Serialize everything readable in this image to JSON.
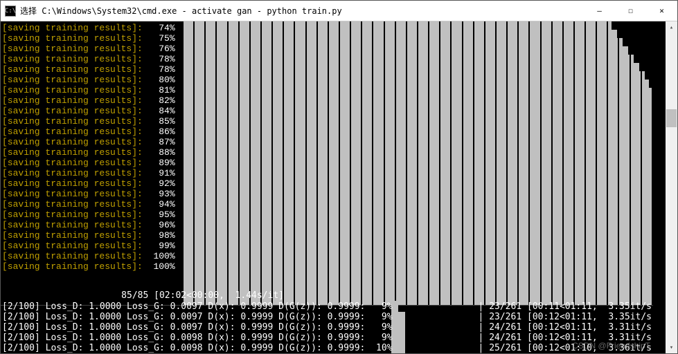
{
  "window": {
    "title": "选择 C:\\Windows\\System32\\cmd.exe - activate  gan - python  train.py",
    "icon_text": "C:\\",
    "btn_min": "—",
    "btn_max": "☐",
    "btn_close": "✕"
  },
  "saving": {
    "label": "[saving training results]:",
    "percents": [
      "74%",
      "75%",
      "76%",
      "78%",
      "78%",
      "80%",
      "81%",
      "82%",
      "84%",
      "85%",
      "86%",
      "87%",
      "88%",
      "89%",
      "91%",
      "92%",
      "93%",
      "94%",
      "95%",
      "96%",
      "98%",
      "99%",
      "100%",
      "100%"
    ]
  },
  "progress": {
    "line": "85/85 [02:02<00:00,  1.44s/it]"
  },
  "loss": [
    {
      "left": "[2/100] Loss_D: 1.0000 Loss_G: 0.0097 D(x): 0.9999 D(G(z)): 0.9999:   9%",
      "right": "23/261 [00:11<01:11,  3.35it/s"
    },
    {
      "left": "[2/100] Loss_D: 1.0000 Loss_G: 0.0097 D(x): 0.9999 D(G(z)): 0.9999:   9%",
      "right": "23/261 [00:12<01:11,  3.35it/s"
    },
    {
      "left": "[2/100] Loss_D: 1.0000 Loss_G: 0.0097 D(x): 0.9999 D(G(z)): 0.9999:   9%",
      "right": "24/261 [00:12<01:11,  3.31it/s"
    },
    {
      "left": "[2/100] Loss_D: 1.0000 Loss_G: 0.0098 D(x): 0.9999 D(G(z)): 0.9999:   9%",
      "right": "24/261 [00:12<01:11,  3.31it/s"
    },
    {
      "left": "[2/100] Loss_D: 1.0000 Loss_G: 0.0098 D(x): 0.9999 D(G(z)): 0.9999:  10%",
      "right": "25/261 [00:12<01:10,  3.36it/s"
    }
  ],
  "watermark": "CSDN @FriendshipT"
}
